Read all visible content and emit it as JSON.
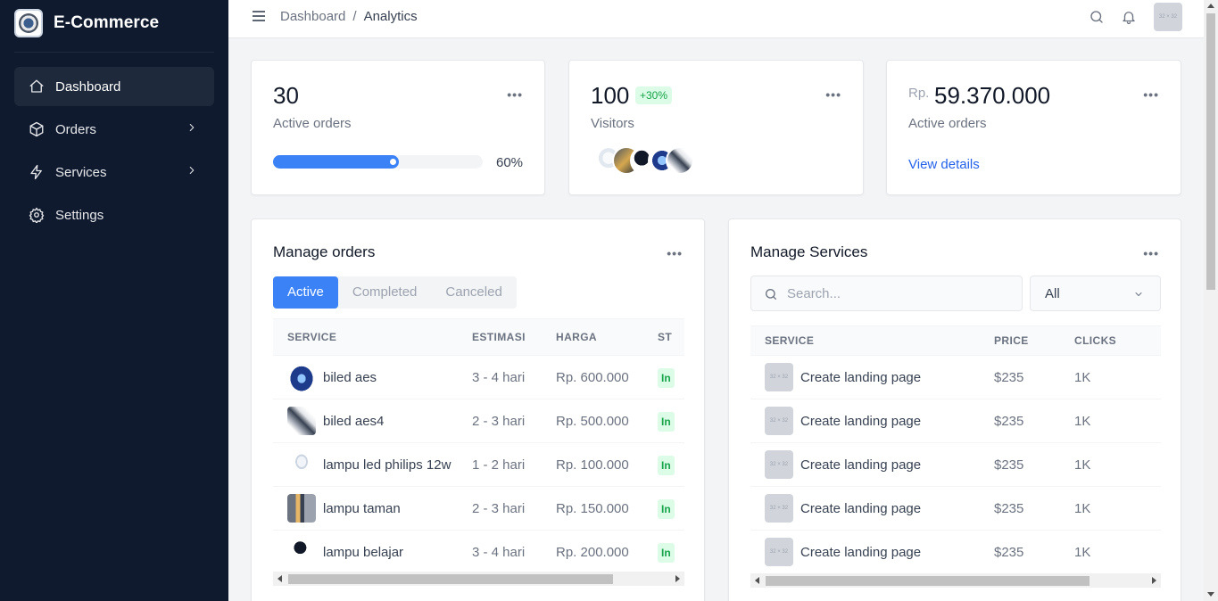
{
  "app": {
    "name": "E-Commerce"
  },
  "sidebar": {
    "items": [
      {
        "label": "Dashboard",
        "icon": "home-icon",
        "active": true
      },
      {
        "label": "Orders",
        "icon": "box-icon",
        "has_submenu": true
      },
      {
        "label": "Services",
        "icon": "lightning-icon",
        "has_submenu": true
      },
      {
        "label": "Settings",
        "icon": "gear-icon"
      }
    ]
  },
  "topbar": {
    "breadcrumb": [
      "Dashboard",
      "Analytics"
    ],
    "avatar_placeholder": "32 × 32"
  },
  "stats": {
    "orders": {
      "value": "30",
      "label": "Active orders",
      "progress_percent": 60,
      "progress_label": "60%"
    },
    "visitors": {
      "value": "100",
      "badge": "+30%",
      "label": "Visitors"
    },
    "revenue": {
      "currency": "Rp.",
      "value": "59.370.000",
      "label": "Active orders",
      "link": "View details"
    }
  },
  "orders_panel": {
    "title": "Manage orders",
    "tabs": [
      "Active",
      "Completed",
      "Canceled"
    ],
    "active_tab": "Active",
    "columns": [
      "SERVICE",
      "ESTIMASI",
      "HARGA",
      "ST"
    ],
    "rows": [
      {
        "service": "biled aes",
        "estimasi": "3 - 4 hari",
        "harga": "Rp. 600.000",
        "status": "In"
      },
      {
        "service": "biled aes4",
        "estimasi": "2 - 3 hari",
        "harga": "Rp. 500.000",
        "status": "In"
      },
      {
        "service": "lampu led philips 12w",
        "estimasi": "1 - 2 hari",
        "harga": "Rp. 100.000",
        "status": "In"
      },
      {
        "service": "lampu taman",
        "estimasi": "2 - 3 hari",
        "harga": "Rp. 150.000",
        "status": "In"
      },
      {
        "service": "lampu belajar",
        "estimasi": "3 - 4 hari",
        "harga": "Rp. 200.000",
        "status": "In"
      }
    ]
  },
  "services_panel": {
    "title": "Manage Services",
    "search_placeholder": "Search...",
    "filter_value": "All",
    "columns": [
      "SERVICE",
      "PRICE",
      "CLICKS"
    ],
    "thumb_placeholder": "32 × 32",
    "rows": [
      {
        "service": "Create landing page",
        "price": "$235",
        "clicks": "1K"
      },
      {
        "service": "Create landing page",
        "price": "$235",
        "clicks": "1K"
      },
      {
        "service": "Create landing page",
        "price": "$235",
        "clicks": "1K"
      },
      {
        "service": "Create landing page",
        "price": "$235",
        "clicks": "1K"
      },
      {
        "service": "Create landing page",
        "price": "$235",
        "clicks": "1K"
      }
    ]
  },
  "colors": {
    "sidebar_bg": "#101a2e",
    "accent": "#3b82f6",
    "success": "#16a34a",
    "link": "#2563eb"
  }
}
